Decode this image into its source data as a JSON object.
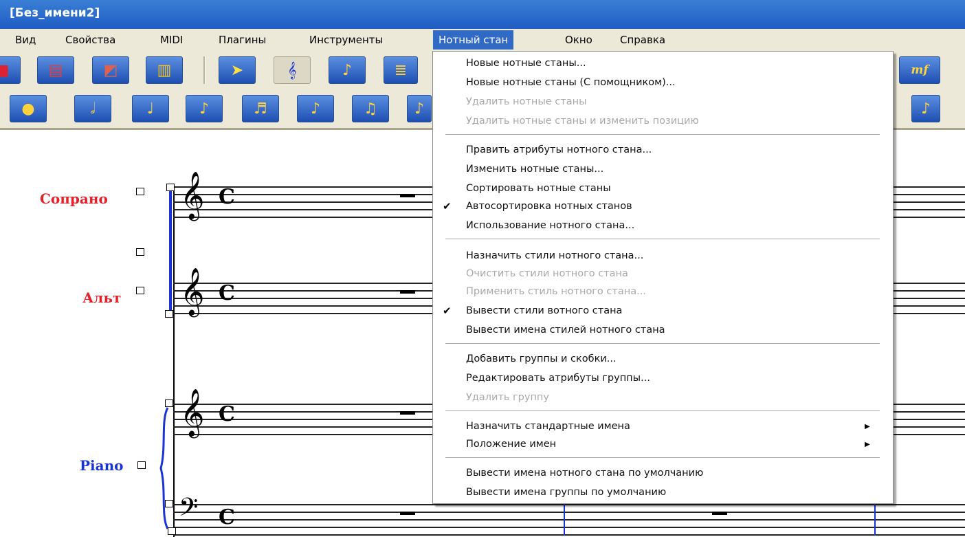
{
  "window": {
    "title": "[Без_имени2]"
  },
  "menubar": {
    "items": [
      "Вид",
      "Свойства",
      "MIDI",
      "Плагины",
      "Инструменты",
      "Нотный стан",
      "Окно",
      "Справка"
    ]
  },
  "toolbar": {
    "row1_icons": [
      "tool-icon",
      "printer-icon",
      "music-stand-icon",
      "keyboard-icon",
      "arrow-select-icon",
      "staff-icon",
      "note-entry-icon",
      "staff-tool-icon",
      "dynamics-icon"
    ],
    "row2_icons": [
      "whole-note-icon",
      "half-note-icon",
      "quarter-note-icon",
      "eighth-note-icon",
      "sixteenth-note-icon",
      "32nd-note-icon",
      "64th-note-icon",
      "128th-note-icon",
      "grace-note-icon"
    ],
    "dynamics_label": "mf"
  },
  "score": {
    "staves": [
      {
        "name": "Сопрано",
        "color": "#e5202a"
      },
      {
        "name": "Альт",
        "color": "#e5202a"
      },
      {
        "name": "Piano",
        "color": "#1a33d6"
      }
    ],
    "time_signature": "C"
  },
  "menu": {
    "items": [
      {
        "label": "Новые нотные станы...",
        "enabled": true,
        "checked": false
      },
      {
        "label": "Новые нотные станы (С помощником)...",
        "enabled": true,
        "checked": false
      },
      {
        "label": "Удалить нотные станы",
        "enabled": false,
        "checked": false
      },
      {
        "label": "Удалить нотные станы и изменить позицию",
        "enabled": false,
        "checked": false
      },
      {
        "label": "Править атрибуты нотного стана...",
        "enabled": true,
        "checked": false
      },
      {
        "label": "Изменить нотные станы...",
        "enabled": true,
        "checked": false
      },
      {
        "label": "Сортировать нотные станы",
        "enabled": true,
        "checked": false
      },
      {
        "label": "Автосортировка нотных станов",
        "enabled": true,
        "checked": true
      },
      {
        "label": "Использование нотного стана...",
        "enabled": true,
        "checked": false
      },
      {
        "label": "Назначить стили нотного стана...",
        "enabled": true,
        "checked": false
      },
      {
        "label": "Очистить стили нотного стана",
        "enabled": false,
        "checked": false
      },
      {
        "label": "Применить стиль нотного стана...",
        "enabled": false,
        "checked": false
      },
      {
        "label": "Вывести стили вотного стана",
        "enabled": true,
        "checked": true
      },
      {
        "label": "Вывести имена стилей нотного стана",
        "enabled": true,
        "checked": false
      },
      {
        "label": "Добавить группы и скобки...",
        "enabled": true,
        "checked": false
      },
      {
        "label": "Редактировать атрибуты группы...",
        "enabled": true,
        "checked": false
      },
      {
        "label": "Удалить группу",
        "enabled": false,
        "checked": false
      },
      {
        "label": "Назначить стандартные имена",
        "enabled": true,
        "checked": false,
        "submenu": true
      },
      {
        "label": "Положение имен",
        "enabled": true,
        "checked": false,
        "submenu": true
      },
      {
        "label": "Вывести имена нотного стана по умолчанию",
        "enabled": true,
        "checked": false
      },
      {
        "label": "Вывести имена группы по умолчанию",
        "enabled": true,
        "checked": false
      }
    ],
    "check_glyph": "✔",
    "submenu_glyph": "▶"
  }
}
